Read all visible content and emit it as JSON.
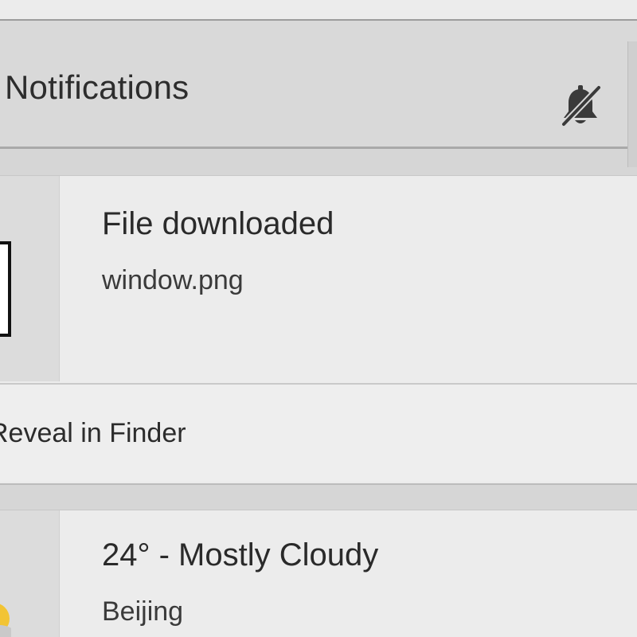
{
  "header": {
    "title": "Notifications",
    "mute_icon": "bell-slash-icon"
  },
  "notifications": [
    {
      "title": "File downloaded",
      "subtitle": "window.png",
      "icon": "file-icon",
      "action_label": "Reveal in Finder"
    },
    {
      "title": "24° - Mostly Cloudy",
      "subtitle": "Beijing",
      "icon": "weather-sun-cloud-icon"
    }
  ],
  "colors": {
    "header_bg": "#d9d9d9",
    "card_bg": "#ececec",
    "text": "#2a2a2a",
    "sun": "#f2c434"
  }
}
